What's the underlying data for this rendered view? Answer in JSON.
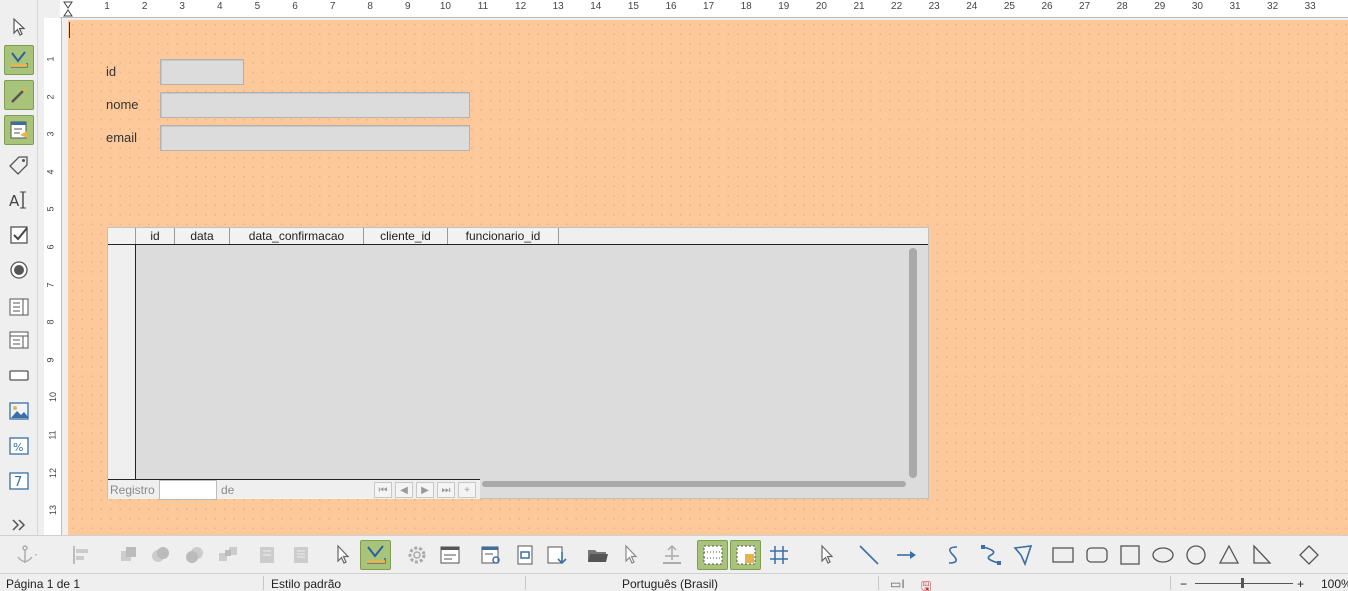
{
  "form": {
    "fields": [
      {
        "label": "id",
        "value": ""
      },
      {
        "label": "nome",
        "value": ""
      },
      {
        "label": "email",
        "value": ""
      }
    ]
  },
  "grid": {
    "columns": [
      "id",
      "data",
      "data_confirmacao",
      "cliente_id",
      "funcionario_id"
    ],
    "nav_record_label": "Registro",
    "nav_of_label": "de",
    "nav_record_value": ""
  },
  "ruler": {
    "h_numbers": [
      "1",
      "2",
      "3",
      "4",
      "5",
      "6",
      "7",
      "8",
      "9",
      "10",
      "11",
      "12",
      "13",
      "14",
      "15",
      "16",
      "17",
      "18",
      "19",
      "20",
      "21",
      "22",
      "23",
      "24",
      "25",
      "26",
      "27",
      "28",
      "29",
      "30",
      "31",
      "32",
      "33"
    ],
    "v_numbers": [
      "1",
      "2",
      "3",
      "4",
      "5",
      "6",
      "7",
      "8",
      "9",
      "10",
      "11",
      "12",
      "13"
    ]
  },
  "statusbar": {
    "page": "Página 1 de 1",
    "style": "Estilo padrão",
    "language": "Português (Brasil)",
    "zoom": "100%"
  },
  "colors": {
    "canvas": "#fdc99a",
    "active_tool": "#a8c47a",
    "field_bg": "#dcdcdc"
  }
}
